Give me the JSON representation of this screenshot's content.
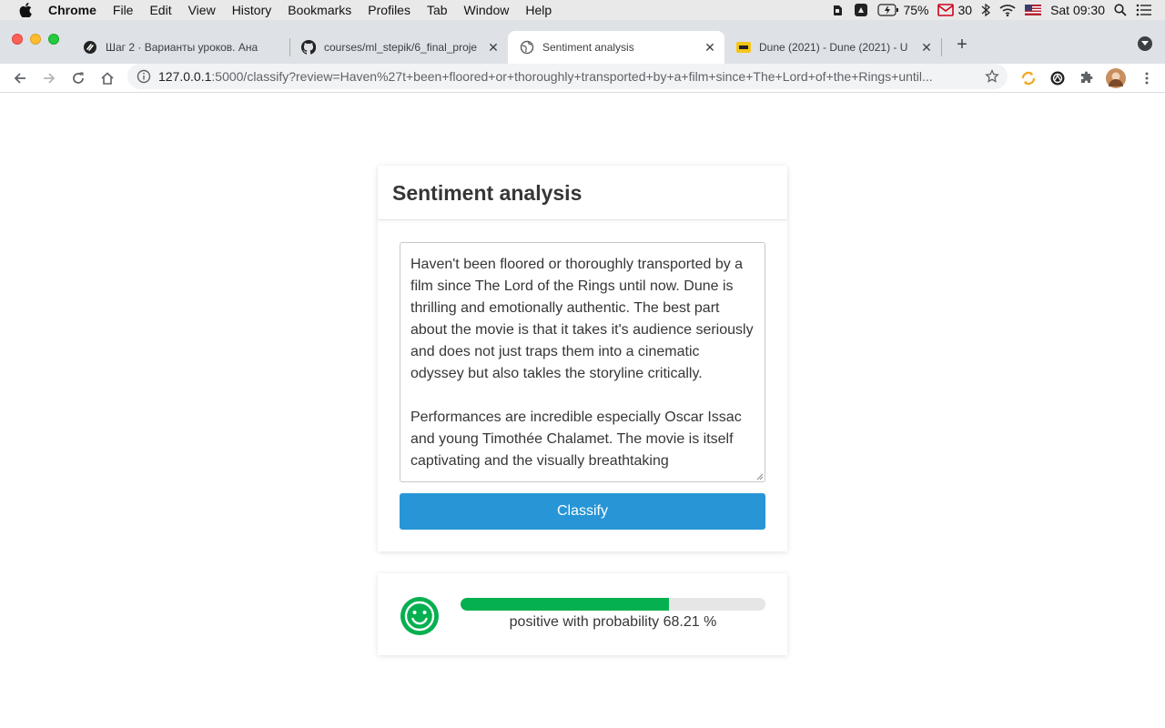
{
  "menubar": {
    "app_name": "Chrome",
    "items": [
      "File",
      "Edit",
      "View",
      "History",
      "Bookmarks",
      "Profiles",
      "Tab",
      "Window",
      "Help"
    ],
    "battery": "75%",
    "mail_count": "30",
    "datetime": "Sat 09:30"
  },
  "tabs": [
    {
      "title": "Шаг 2 · Варианты уроков. Ана",
      "icon": "stepik-icon"
    },
    {
      "title": "courses/ml_stepik/6_final_proje",
      "icon": "github-icon"
    },
    {
      "title": "Sentiment analysis",
      "icon": "globe-icon",
      "active": true
    },
    {
      "title": "Dune (2021) - Dune (2021) - U",
      "icon": "imdb-icon"
    }
  ],
  "address_bar": {
    "host": "127.0.0.1",
    "rest": ":5000/classify?review=Haven%27t+been+floored+or+thoroughly+transported+by+a+film+since+The+Lord+of+the+Rings+until..."
  },
  "page": {
    "title": "Sentiment analysis",
    "review_text": "Haven't been floored or thoroughly transported by a film since The Lord of the Rings until now. Dune is thrilling and emotionally authentic. The best part about the movie is that it takes it's audience seriously and does not just traps them into a cinematic odyssey but also takles the storyline critically.\n\nPerformances are incredible especially Oscar Issac and young Timothée Chalamet. The movie is itself captivating and the visually breathtaking",
    "classify_label": "Classify",
    "result_text": "positive with probability 68.21 %",
    "probability": 0.6821,
    "result_color": "#05b050",
    "accent_color": "#2795d6"
  }
}
